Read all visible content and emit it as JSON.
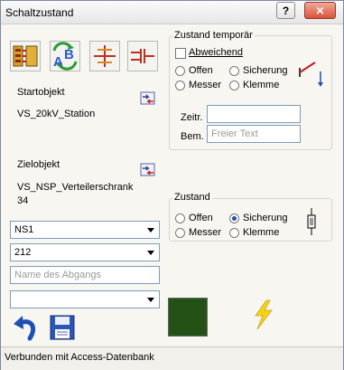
{
  "window": {
    "title": "Schaltzustand"
  },
  "titlebar": {
    "help_glyph": "?",
    "close_glyph": "✕"
  },
  "toolbar": {
    "icons": [
      "switchboard-icon",
      "text-ab-icon",
      "branch-icon",
      "cable-icon"
    ]
  },
  "start_object": {
    "label": "Startobjekt",
    "value": "VS_20kV_Station"
  },
  "target_object": {
    "label": "Zielobjekt",
    "value_line1": "VS_NSP_Verteilerschrank",
    "value_line2": "34"
  },
  "combos": {
    "first": "NS1",
    "second": "212",
    "fourth": ""
  },
  "outlet_name": {
    "placeholder": "Name des Abgangs"
  },
  "temp_state": {
    "title": "Zustand temporär",
    "deviating_label": "Abweichend",
    "deviating_checked": false,
    "options": [
      "Offen",
      "Sicherung",
      "Messer",
      "Klemme"
    ],
    "time_label": "Zeitr.",
    "time_value": "",
    "remark_label": "Bem.",
    "remark_placeholder": "Freier Text"
  },
  "state": {
    "title": "Zustand",
    "options": [
      "Offen",
      "Sicherung",
      "Messer",
      "Klemme"
    ],
    "selected": "Sicherung"
  },
  "colors": {
    "state_swatch": "#245216",
    "lightning": "#f5d21a",
    "accent": "#1f4fa8"
  },
  "status": {
    "text": "Verbunden mit Access-Datenbank"
  }
}
